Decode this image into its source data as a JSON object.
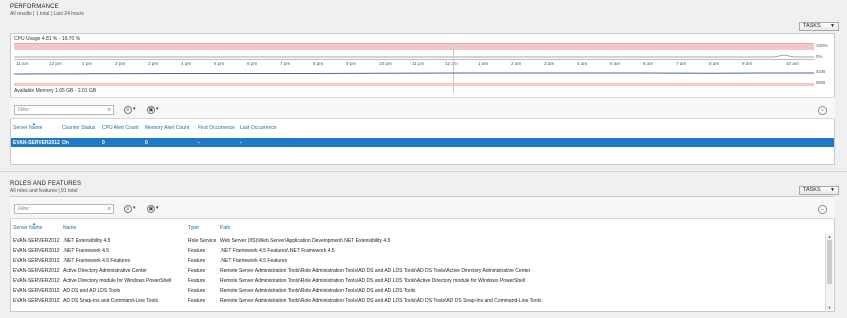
{
  "performance": {
    "title": "PERFORMANCE",
    "subtitle": "All results | 1 total | Last 24 hours",
    "tasks_label": "TASKS",
    "cpu_label": "CPU Usage  4.81 % - 16.70 %",
    "cpu_scale": [
      "100%",
      "0%"
    ],
    "mem_scale": [
      "4GB",
      "0GB"
    ],
    "mem_label": "Available Memory  1.65 GB - 2.01 GB",
    "time_ticks": [
      "11 am",
      "12 pm",
      "1 pm",
      "2 pm",
      "3 pm",
      "4 pm",
      "5 pm",
      "6 pm",
      "7 pm",
      "8 pm",
      "9 pm",
      "10 pm",
      "11 pm",
      "12 am",
      "1 am",
      "2 am",
      "3 am",
      "4 am",
      "5 am",
      "6 am",
      "7 am",
      "8 am",
      "9 am",
      "10 am"
    ],
    "filter_placeholder": "Filter",
    "columns": [
      "Server Name",
      "Counter Status",
      "CPU Alert Count",
      "Memory Alert Count",
      "First Occurrence",
      "Last Occurrence"
    ],
    "rows": [
      [
        "EVAN-SERVER2012",
        "On",
        "0",
        "0",
        "-",
        "-"
      ]
    ]
  },
  "roles": {
    "title": "ROLES AND FEATURES",
    "subtitle": "All roles and features | 91 total",
    "tasks_label": "TASKS",
    "filter_placeholder": "Filter",
    "columns": [
      "Server Name",
      "Name",
      "Type",
      "Path"
    ],
    "rows": [
      [
        "EVAN-SERVER2012",
        ".NET Extensibility 4.5",
        "Role Service",
        "Web Server (IIS)\\Web Server\\Application Development\\.NET Extensibility 4.5"
      ],
      [
        "EVAN-SERVER2012",
        ".NET Framework 4.5",
        "Feature",
        ".NET Framework 4.5 Features\\.NET Framework 4.5"
      ],
      [
        "EVAN-SERVER2012",
        ".NET Framework 4.5 Features",
        "Feature",
        ".NET Framework 4.5 Features"
      ],
      [
        "EVAN-SERVER2012",
        "Active Directory Administrative Center",
        "Feature",
        "Remote Server Administration Tools\\Role Administration Tools\\AD DS and AD LDS Tools\\AD DS Tools\\Active Directory Administrative Center"
      ],
      [
        "EVAN-SERVER2012",
        "Active Directory module for Windows PowerShell",
        "Feature",
        "Remote Server Administration Tools\\Role Administration Tools\\AD DS and AD LDS Tools\\Active Directory module for Windows PowerShell"
      ],
      [
        "EVAN-SERVER2012",
        "AD DS and AD LDS Tools",
        "Feature",
        "Remote Server Administration Tools\\Role Administration Tools\\AD DS and AD LDS Tools"
      ],
      [
        "EVAN-SERVER2012",
        "AD DS Snap-Ins and Command-Line Tools",
        "Feature",
        "Remote Server Administration Tools\\Role Administration Tools\\AD DS and AD LDS Tools\\AD DS Tools\\AD DS Snap-Ins and Command-Line Tools"
      ]
    ]
  },
  "icons": {
    "search": "magnifier-icon",
    "save_query": "save-icon",
    "toggle": "chevron-down-icon"
  }
}
